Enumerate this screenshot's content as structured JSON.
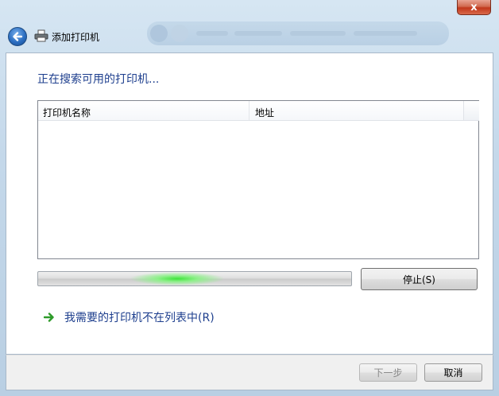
{
  "window": {
    "title": "添加打印机",
    "close_glyph": "x",
    "close_icon": "close-icon"
  },
  "main": {
    "heading": "正在搜索可用的打印机...",
    "list": {
      "columns": [
        "打印机名称",
        "地址"
      ],
      "rows": []
    },
    "progress": {
      "state": "indeterminate",
      "color": "#3ee33a"
    },
    "stop_button": "停止(S)",
    "not_listed_link": "我需要的打印机不在列表中(R)"
  },
  "footer": {
    "next_button": "下一步",
    "cancel_button": "取消"
  },
  "colors": {
    "heading": "#1e3f8e",
    "link": "#1e3f8e",
    "close_button": "#c1371a"
  },
  "icons": {
    "back": "back-arrow-icon",
    "printer": "printer-icon",
    "link_arrow": "green-arrow-icon"
  }
}
